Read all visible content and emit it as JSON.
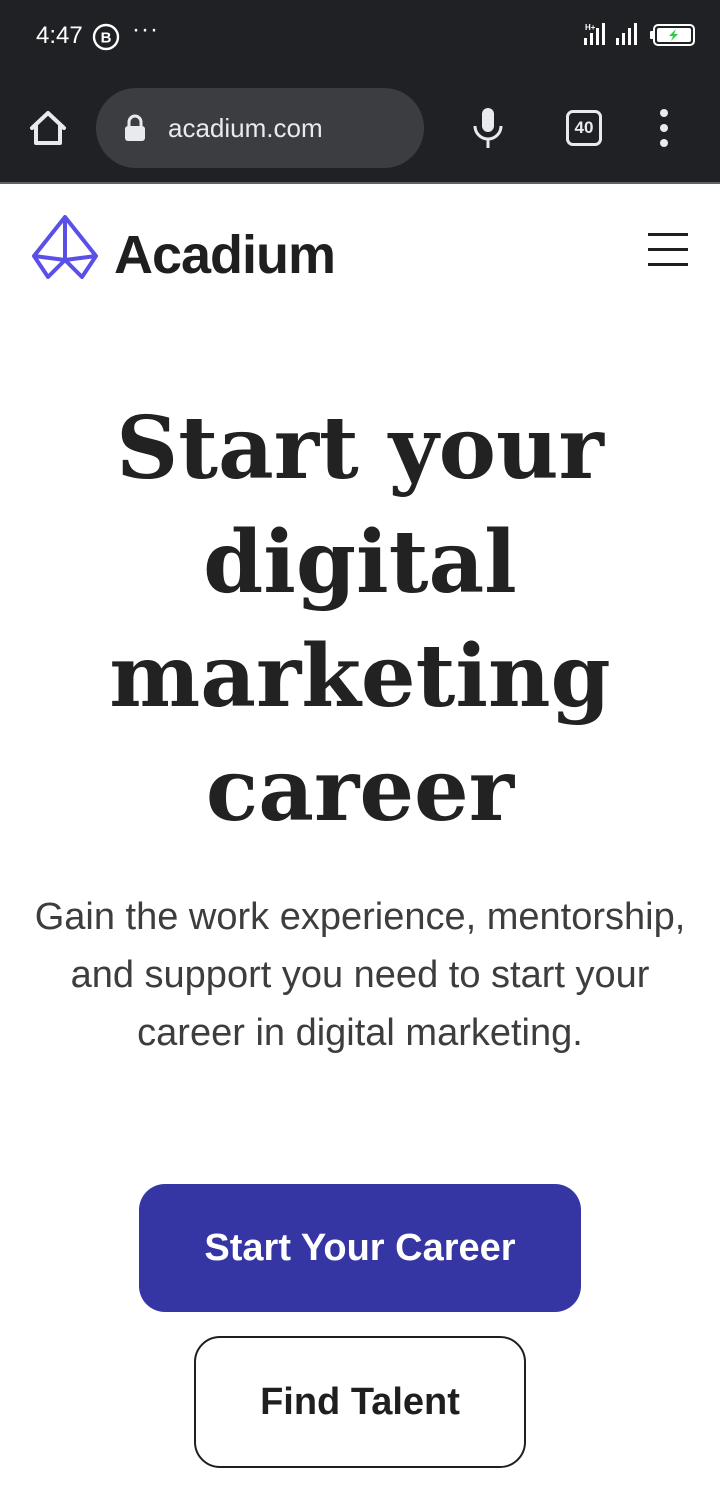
{
  "status_bar": {
    "time": "4:47",
    "notification_badge": "B",
    "more_indicator": "···",
    "icons": [
      "b-badge-icon",
      "signal-icon",
      "signal-icon",
      "battery-charging-icon"
    ]
  },
  "browser": {
    "url": "acadium.com",
    "tab_count": "40",
    "icons": [
      "home-icon",
      "lock-icon",
      "microphone-icon",
      "more-vert-icon"
    ]
  },
  "site": {
    "brand_name": "Acadium",
    "logo_color": "#5b4fe8",
    "menu_icon": "hamburger-icon"
  },
  "hero": {
    "title": "Start your digital marketing career",
    "subtitle": "Gain the work experience, mentorship, and support you need to start your career in digital marketing."
  },
  "cta": {
    "primary_label": "Start Your Career",
    "secondary_label": "Find Talent",
    "primary_color": "#3535a3"
  }
}
